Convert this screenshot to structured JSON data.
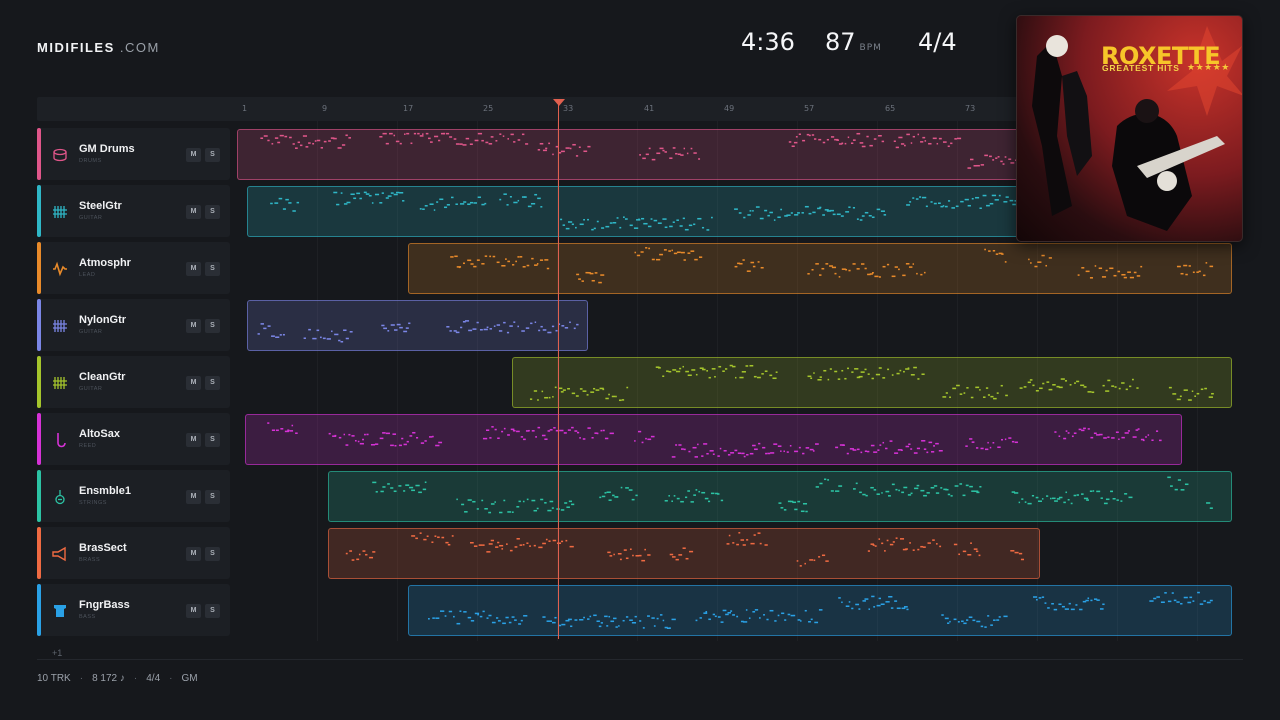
{
  "brand": {
    "name": "MIDIFILES",
    "suffix": ".COM"
  },
  "transport": {
    "time": "4:36",
    "bpm": "87",
    "bpm_unit": "BPM",
    "signature": "4/4"
  },
  "ruler": {
    "bars": [
      "1",
      "9",
      "17",
      "25",
      "33",
      "41",
      "49",
      "57",
      "65",
      "73"
    ]
  },
  "tracks": [
    {
      "name": "GM Drums",
      "category": "DRUMS",
      "icon": "drum-icon",
      "color": "#e0568a",
      "mute": "M",
      "solo": "S"
    },
    {
      "name": "SteelGtr",
      "category": "GUITAR",
      "icon": "guitar-grid-icon",
      "color": "#2fb7c7",
      "mute": "M",
      "solo": "S"
    },
    {
      "name": "Atmosphr",
      "category": "LEAD",
      "icon": "waveform-icon",
      "color": "#e88a2a",
      "mute": "M",
      "solo": "S"
    },
    {
      "name": "NylonGtr",
      "category": "GUITAR",
      "icon": "guitar-grid-icon",
      "color": "#7b86e6",
      "mute": "M",
      "solo": "S"
    },
    {
      "name": "CleanGtr",
      "category": "GUITAR",
      "icon": "guitar-grid-icon",
      "color": "#a5c52c",
      "mute": "M",
      "solo": "S"
    },
    {
      "name": "AltoSax",
      "category": "REED",
      "icon": "saxophone-icon",
      "color": "#d632d6",
      "mute": "M",
      "solo": "S"
    },
    {
      "name": "Ensmble1",
      "category": "STRINGS",
      "icon": "violin-icon",
      "color": "#2cc3a4",
      "mute": "M",
      "solo": "S"
    },
    {
      "name": "BrasSect",
      "category": "BRASS",
      "icon": "horn-icon",
      "color": "#ef6a42",
      "mute": "M",
      "solo": "S"
    },
    {
      "name": "FngrBass",
      "category": "BASS",
      "icon": "bass-icon",
      "color": "#2aa1e6",
      "mute": "M",
      "solo": "S"
    }
  ],
  "more_tracks": "+1",
  "footer": {
    "tracks": "10 TRK",
    "notes": "8 172 ♪",
    "signature": "4/4",
    "standard": "GM"
  },
  "album": {
    "artist": "ROXETTE",
    "title": "GREATEST HITS",
    "stars": "★★★★★"
  }
}
